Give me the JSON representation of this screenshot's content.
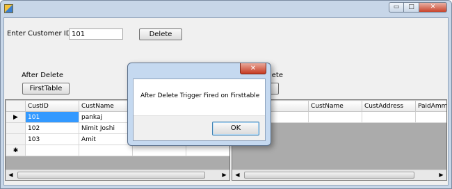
{
  "form": {
    "customer_id_label": "Enter Customer ID:",
    "customer_id_value": "101",
    "delete_label": "Delete",
    "after_delete_label": "After Delete",
    "first_table_label": "FirstTable",
    "right_label_fragment": "lete"
  },
  "left_grid": {
    "columns": [
      "CustID",
      "CustName"
    ],
    "rows": [
      {
        "marker": "▶",
        "cells": [
          "101",
          "pankaj"
        ]
      },
      {
        "marker": "",
        "cells": [
          "102",
          "Nimit Joshi"
        ]
      },
      {
        "marker": "",
        "cells": [
          "103",
          "Amit"
        ]
      },
      {
        "marker": "✱",
        "cells": [
          "",
          ""
        ]
      }
    ]
  },
  "right_grid": {
    "columns": [
      "D",
      "CustName",
      "CustAddress",
      "PaidAmmou"
    ],
    "rows": [
      {
        "marker": "",
        "cells": [
          "",
          "",
          "",
          ""
        ]
      }
    ]
  },
  "dialog": {
    "close_label": "✕",
    "message": "After Delete Trigger Fired on Firsttable",
    "ok_label": "OK"
  },
  "window": {
    "min_glyph": "▭",
    "max_glyph": "□",
    "close_glyph": "✕"
  }
}
